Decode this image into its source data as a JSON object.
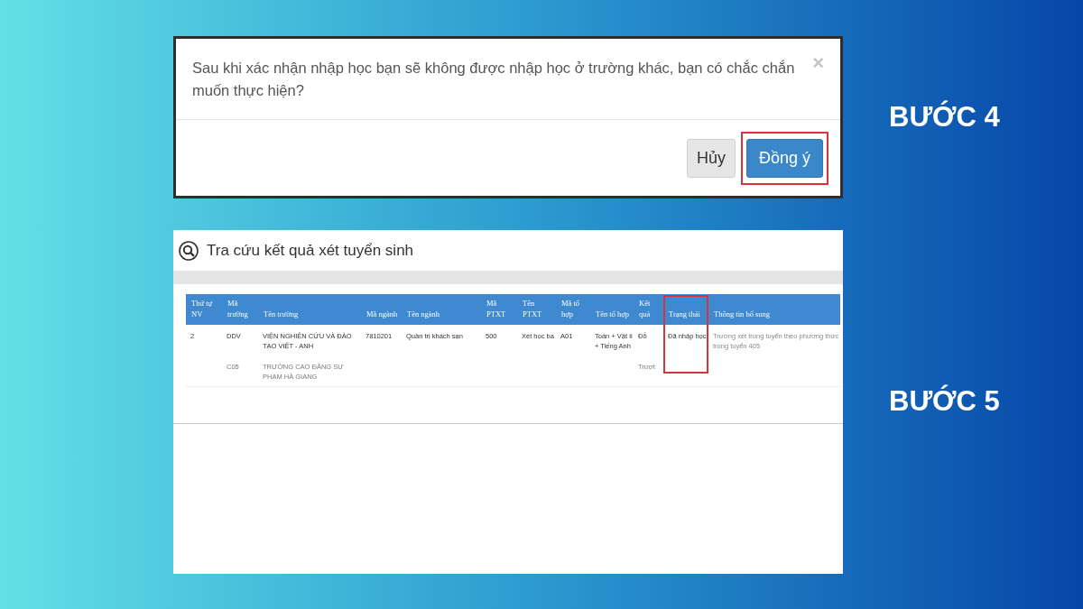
{
  "steps": [
    {
      "kind": "confirm_dialog",
      "label": "BƯỚC 4",
      "dialog": {
        "message": "Sau khi xác nhận nhập học bạn sẽ không được nhập học ở trường khác, bạn có chắc chắn muốn thực hiện?",
        "close_label": "×",
        "buttons": [
          {
            "label": "Hủy",
            "kind": "secondary",
            "highlighted": false
          },
          {
            "label": "Đồng ý",
            "kind": "primary",
            "highlighted": true
          }
        ]
      }
    },
    {
      "kind": "results_page",
      "label": "BƯỚC 5",
      "page": {
        "title": "Tra cứu kết quả xét tuyển sinh",
        "table": {
          "columns": [
            {
              "label": "Thứ tự NV",
              "highlighted": false
            },
            {
              "label": "Mã trường",
              "highlighted": false
            },
            {
              "label": "Tên trường",
              "highlighted": false
            },
            {
              "label": "Mã ngành",
              "highlighted": false
            },
            {
              "label": "Tên ngành",
              "highlighted": false
            },
            {
              "label": "Mã PTXT",
              "highlighted": false
            },
            {
              "label": "Tên PTXT",
              "highlighted": false
            },
            {
              "label": "Mã tổ hợp",
              "highlighted": false
            },
            {
              "label": "Tên tổ hợp",
              "highlighted": false
            },
            {
              "label": "Kết quả",
              "highlighted": false
            },
            {
              "label": "Trạng thái",
              "highlighted": true
            },
            {
              "label": "Thông tin bổ sung",
              "highlighted": false
            }
          ],
          "rows": [
            {
              "dimmed": false,
              "order": "2",
              "school_code": "DDV",
              "school_name": "VIỆN NGHIÊN CỨU VÀ ĐÀO TẠO VIỆT - ANH",
              "major_code": "7810201",
              "major_name": "Quản trị khách sạn",
              "method_code": "500",
              "method_name": "Xét học ba",
              "combo_code": "A01",
              "combo_name": "Toán + Vật lí + Tiếng Anh",
              "result": "Đỗ",
              "status": "Đã nhập học",
              "note": "Trường xét trúng tuyển theo phương thức trúng tuyển 405"
            },
            {
              "dimmed": true,
              "school_code": "C05",
              "school_name": "TRƯỜNG CAO ĐẲNG SƯ PHẠM HÀ GIANG",
              "result": "Trượt"
            }
          ]
        }
      }
    }
  ]
}
